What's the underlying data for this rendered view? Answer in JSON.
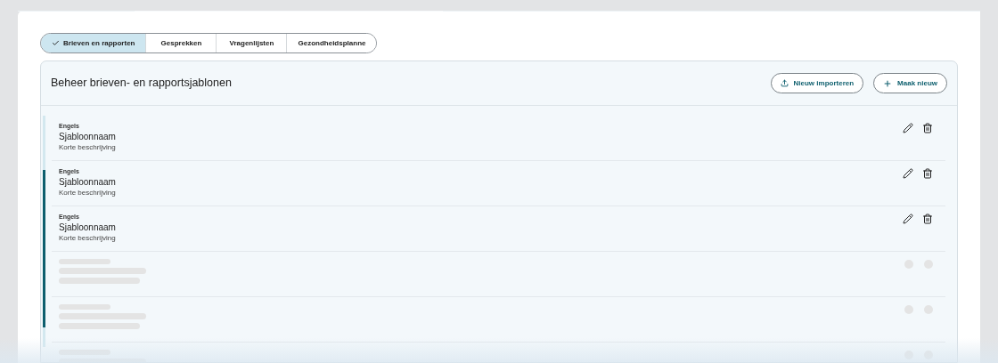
{
  "tabs": [
    {
      "label": "Brieven en rapporten",
      "selected": true
    },
    {
      "label": "Gesprekken",
      "selected": false
    },
    {
      "label": "Vragenlijsten",
      "selected": false
    },
    {
      "label": "Gezondheidsplanne",
      "selected": false
    }
  ],
  "panel": {
    "title": "Beheer brieven- en rapportsjablonen",
    "buttons": [
      {
        "kind": "import",
        "label": "Nieuw importeren"
      },
      {
        "kind": "add",
        "label": "Maak nieuw"
      }
    ]
  },
  "templates": [
    {
      "kind": "template",
      "language": "Engels",
      "name": "Sjabloonnaam",
      "description": "Korte beschrijving"
    },
    {
      "kind": "template",
      "language": "Engels",
      "name": "Sjabloonnaam",
      "description": "Korte beschrijving"
    },
    {
      "kind": "template",
      "language": "Engels",
      "name": "Sjabloonnaam",
      "description": "Korte beschrijving"
    },
    {
      "kind": "skeleton"
    },
    {
      "kind": "skeleton"
    },
    {
      "kind": "skeleton"
    }
  ]
}
